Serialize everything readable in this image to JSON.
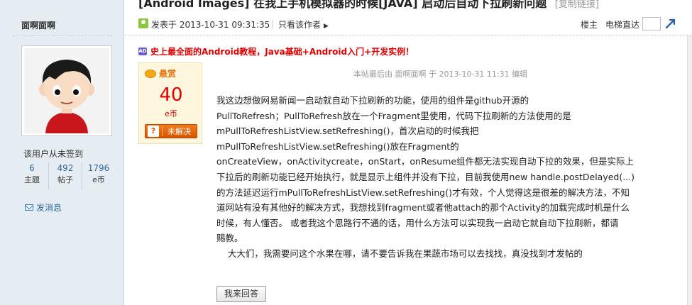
{
  "thread": {
    "title_clipped": "[Android Images] 在我上手机模拟器的时候[JAVA] 启动后自动下拉刷新问题",
    "title_tag": "[复制链接]"
  },
  "author": {
    "name": "面啊面啊",
    "checkin_status": "该用户从未签到",
    "stats": [
      {
        "value": "6",
        "label": "主题"
      },
      {
        "value": "492",
        "label": "帖子"
      },
      {
        "value": "1796",
        "label": "e币"
      }
    ],
    "send_message_label": "发消息"
  },
  "post_header": {
    "posted_at": "发表于 2013-10-31 09:31:35",
    "divider": "|",
    "only_author": "只看该作者",
    "floor_label": "楼主",
    "elevator_label": "电梯直达",
    "elevator_value": ""
  },
  "ad": {
    "badge": "AD",
    "text": "史上最全面的Android教程，Java基础+Android入门+开发实例！"
  },
  "reward": {
    "title": "悬赏",
    "amount": "40",
    "unit": "e币",
    "status_label": "未解决",
    "status_icon": "?"
  },
  "edit_note": "本帖最后由 面啊面啊 于 2013-10-31 11:31 编辑",
  "content_lines": [
    "我这边想做网易新闻一启动就自动下拉刷新的功能，使用的组件是github开源的",
    "PullToRefresh；PullToRefresh放在一个Fragment里使用，代码下拉刷新的方法使用的是",
    "mPullToRefreshListView.setRefreshing()，首次启动的时候我把",
    "mPullToRefreshListView.setRefreshing()放在Fragment的",
    "onCreateView，onActivitycreate，onStart，onResume组件都无法实现自动下拉的效果，但是实际上",
    "下拉后的刷新功能已经开始执行，就是显示上组件并没有下拉，目前我使用new handle.postDelayed(...)",
    "的方法延迟运行mPullToRefreshListView.setRefreshing()才有效，个人觉得这是很差的解决方法，不知",
    "道网站有没有其他好的解决方式，我想找到fragment或者他attach的那个Activity的加载完成时机是什么",
    "时候，有人懂否。    或者我这个思路行不通的话，用什么方法可以实现我一启动它就自动下拉刷新，都请",
    "赐教。",
    "    大大们，我需要问这个水果在哪，请不要告诉我在果蔬市场可以去找找，真没找到才发帖的"
  ],
  "reply_button": "我来回答",
  "colors": {
    "sidebar_bg": "#e5edf2",
    "link_blue": "#336699",
    "ad_red": "#e50000",
    "reward_bg": "#fff6de",
    "unsolved_orange": "#d85500"
  },
  "icons": [
    "poster-icon",
    "go-arrow-icon",
    "ad-icon",
    "coin-icon",
    "envelope-icon",
    "avatar-cartoon"
  ]
}
